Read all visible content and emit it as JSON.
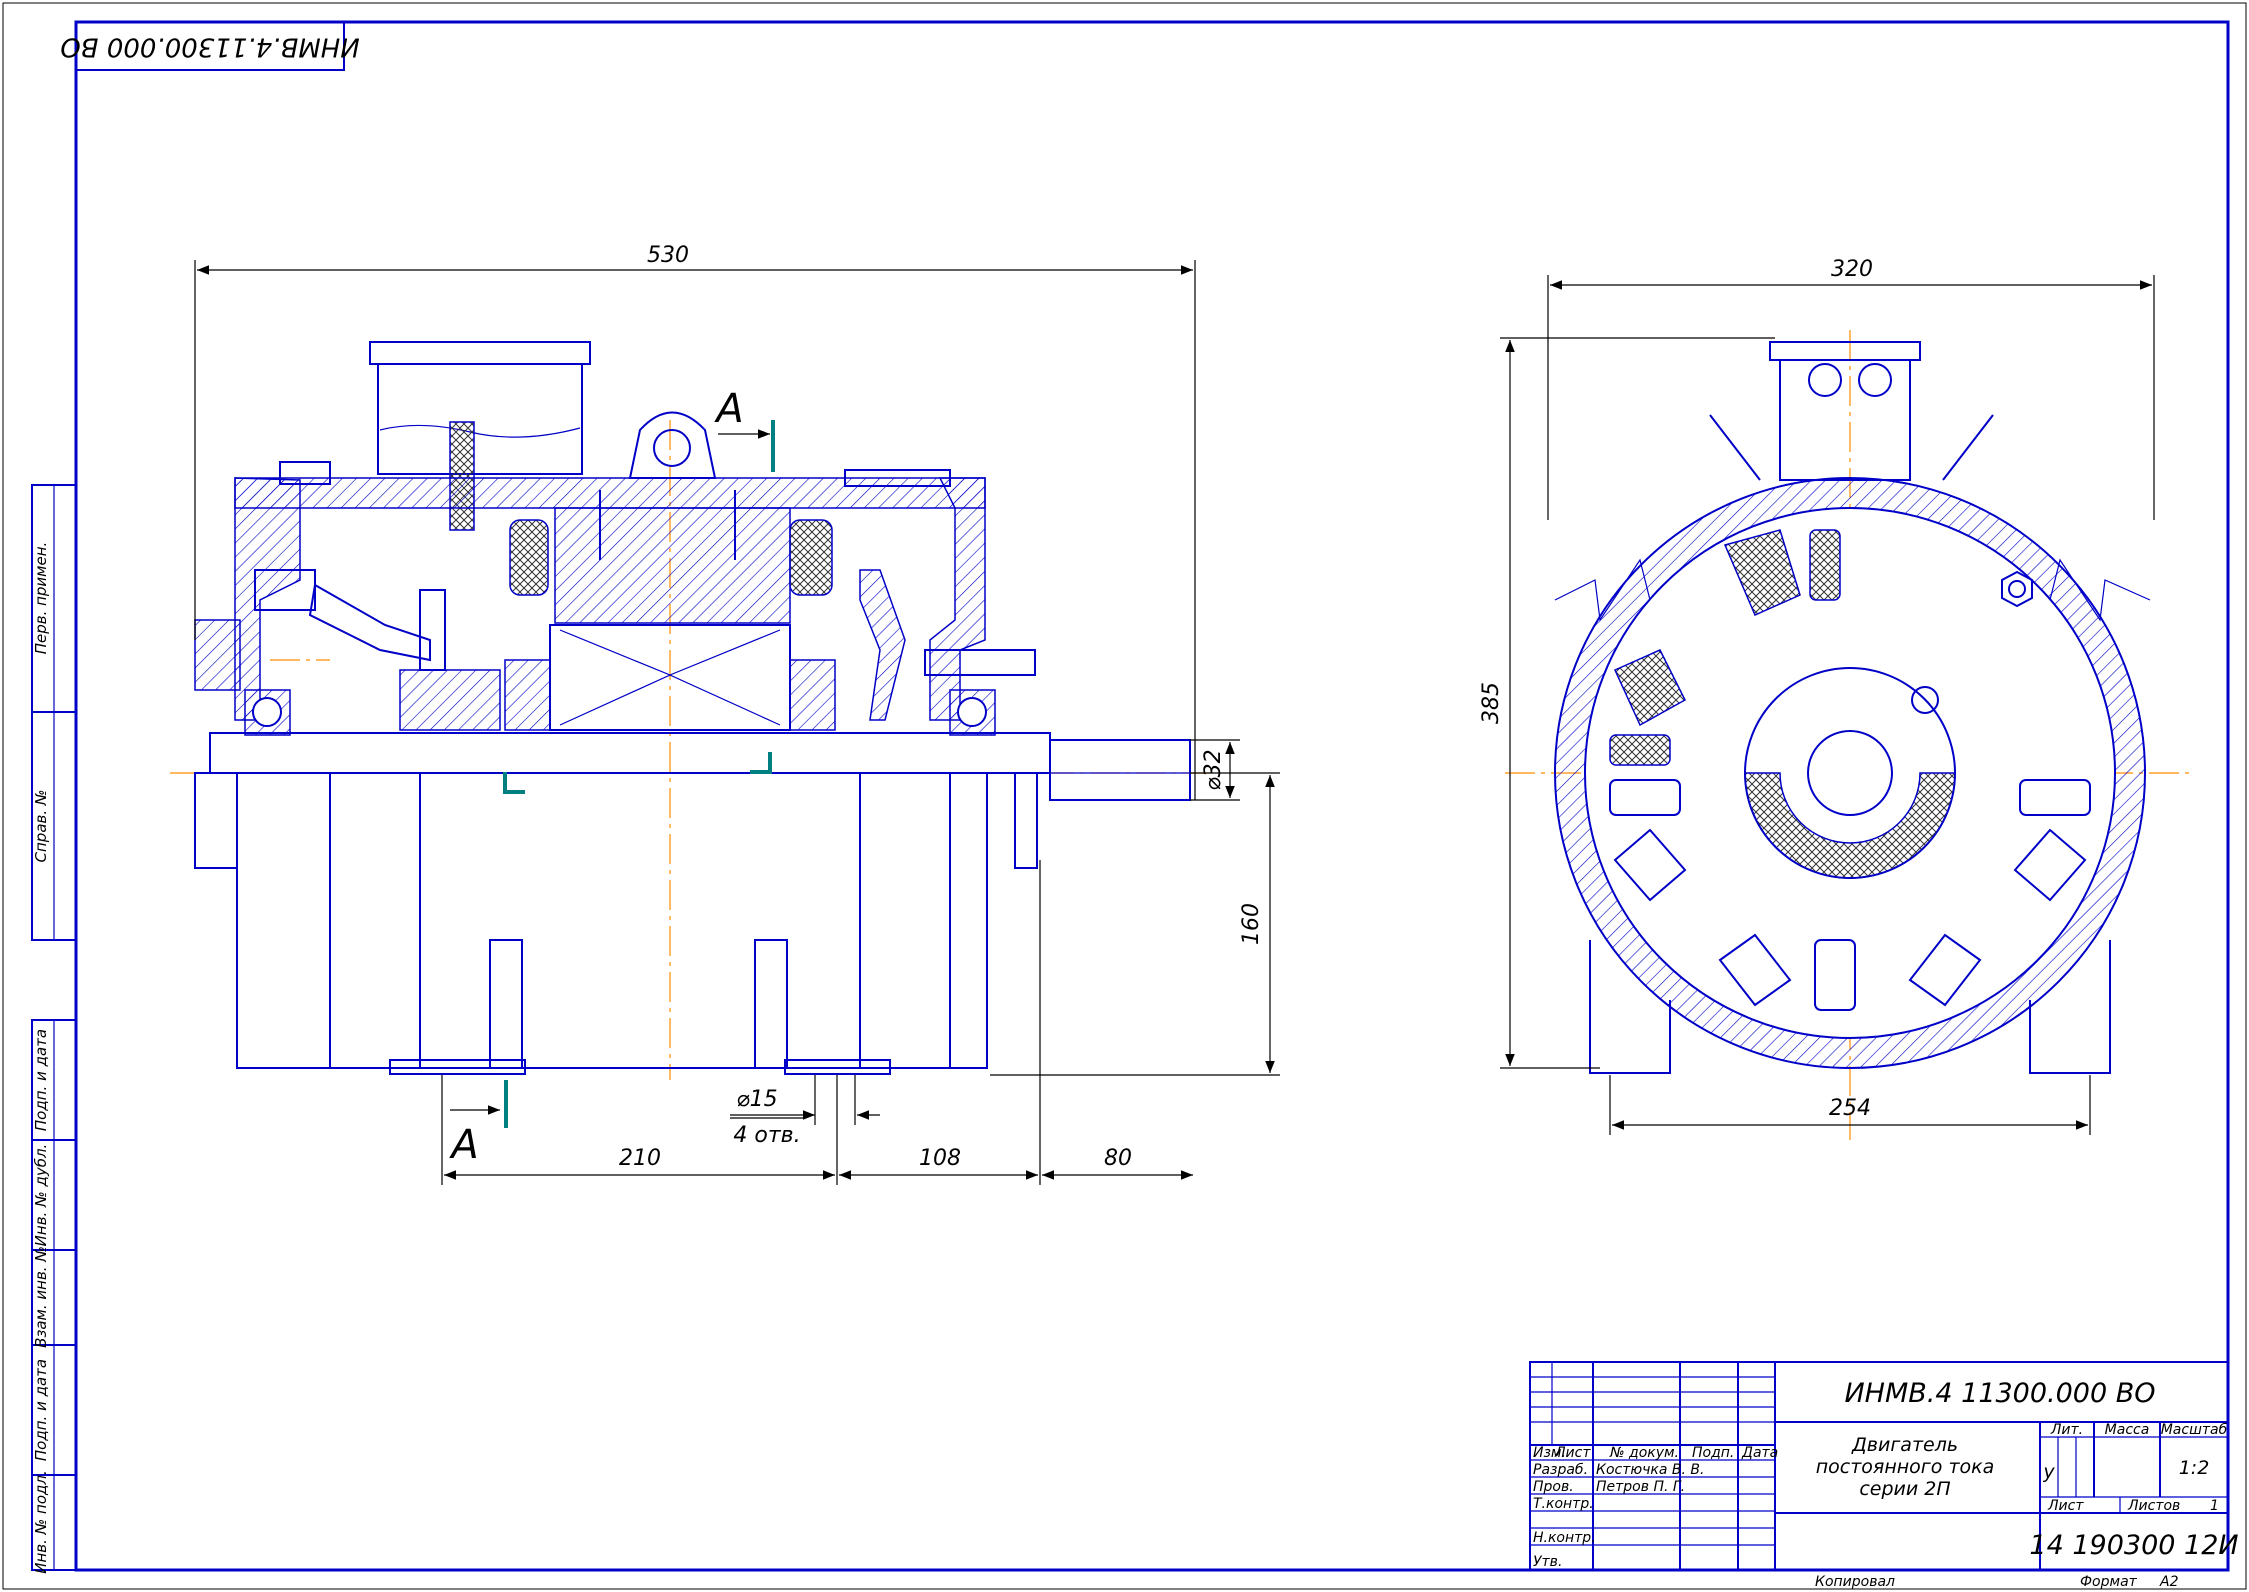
{
  "stamp_top": "ИНМВ.4.11300.000 ВО",
  "side_strip": [
    "Перв. примен.",
    "Справ. №",
    "Подп. и дата",
    "Инв. № дубл.",
    "Взам. инв. №",
    "Подп. и дата",
    "Инв. № подл."
  ],
  "dimensions": {
    "d530": "530",
    "d320": "320",
    "d385": "385",
    "d160": "160",
    "d32": "⌀32",
    "d15": "⌀15",
    "holes": "4 отв.",
    "d210": "210",
    "d108": "108",
    "d80": "80",
    "d254": "254"
  },
  "section": {
    "top": "А",
    "bottom": "А"
  },
  "title_block": {
    "designation": "ИНМВ.4 11300.000 ВО",
    "name_line1": "Двигатель",
    "name_line2": "постоянного тока",
    "name_line3": "серии 2П",
    "hdr_izm": "Изм.",
    "hdr_list": "Лист",
    "hdr_ndoc": "№ докум.",
    "hdr_podp": "Подп.",
    "hdr_data": "Дата",
    "razrab": "Разраб.",
    "razrab_name": "Костючка В. В.",
    "prov": "Пров.",
    "prov_name": "Петров П. Г.",
    "tkontr": "Т.контр.",
    "nkontr": "Н.контр.",
    "utv": "Утв.",
    "lit": "Лит.",
    "massa": "Масса",
    "masshtab": "Масштаб",
    "lit_val": "у",
    "scale_val": "1:2",
    "sheet": "Лист",
    "sheets": "Листов",
    "sheets_val": "1",
    "org": "14 190300 12И",
    "kopiroval": "Копировал",
    "format": "Формат",
    "format_val": "А2"
  }
}
